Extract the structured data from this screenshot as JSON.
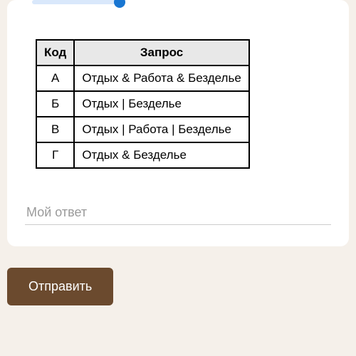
{
  "table": {
    "headers": {
      "code": "Код",
      "query": "Запрос"
    },
    "rows": [
      {
        "code": "А",
        "query": "Отдых & Работа & Безделье"
      },
      {
        "code": "Б",
        "query": "Отдых | Безделье"
      },
      {
        "code": "В",
        "query": "Отдых | Работа | Безделье"
      },
      {
        "code": "Г",
        "query": "Отдых & Безделье"
      }
    ]
  },
  "answer": {
    "placeholder": "Мой ответ",
    "value": ""
  },
  "submit": {
    "label": "Отправить"
  }
}
